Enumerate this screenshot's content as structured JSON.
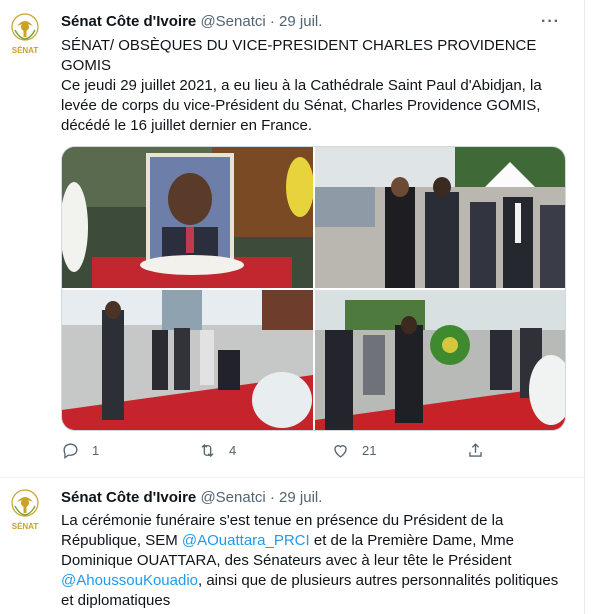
{
  "tweets": [
    {
      "author_name": "Sénat Côte d'Ivoire",
      "handle": "@Senatci",
      "separator": "·",
      "date": "29 juil.",
      "avatar_label": "SÉNAT",
      "title": "SÉNAT/ OBSÈQUES DU VICE-PRESIDENT CHARLES PROVIDENCE GOMIS",
      "body": "Ce jeudi 29 juillet 2021, a eu lieu à la Cathédrale Saint Paul d'Abidjan, la levée de corps du vice-Président du Sénat, Charles Providence GOMIS, décédé le 16 juillet dernier en France.",
      "stats": {
        "replies": "1",
        "retweets": "4",
        "likes": "21"
      }
    },
    {
      "author_name": "Sénat Côte d'Ivoire",
      "handle": "@Senatci",
      "separator": "·",
      "date": "29 juil.",
      "avatar_label": "SÉNAT",
      "body_parts": {
        "p1": "La cérémonie funéraire s'est tenue en présence du Président de la République, SEM ",
        "m1": "@AOuattara_PRCI",
        "p2": "  et de la Première Dame, Mme Dominique OUATTARA, des Sénateurs avec à leur tête le Président ",
        "m2": "@AhoussouKouadio",
        "p3": ", ainsi que de plusieurs autres personnalités politiques et diplomatiques"
      }
    }
  ],
  "more_label": "···",
  "colors": {
    "accent": "#1d9bf0",
    "muted": "#536471",
    "text": "#0f1419",
    "gold": "#c9a227"
  },
  "icons": [
    "reply-icon",
    "retweet-icon",
    "like-icon",
    "share-icon",
    "more-icon",
    "senat-logo"
  ]
}
